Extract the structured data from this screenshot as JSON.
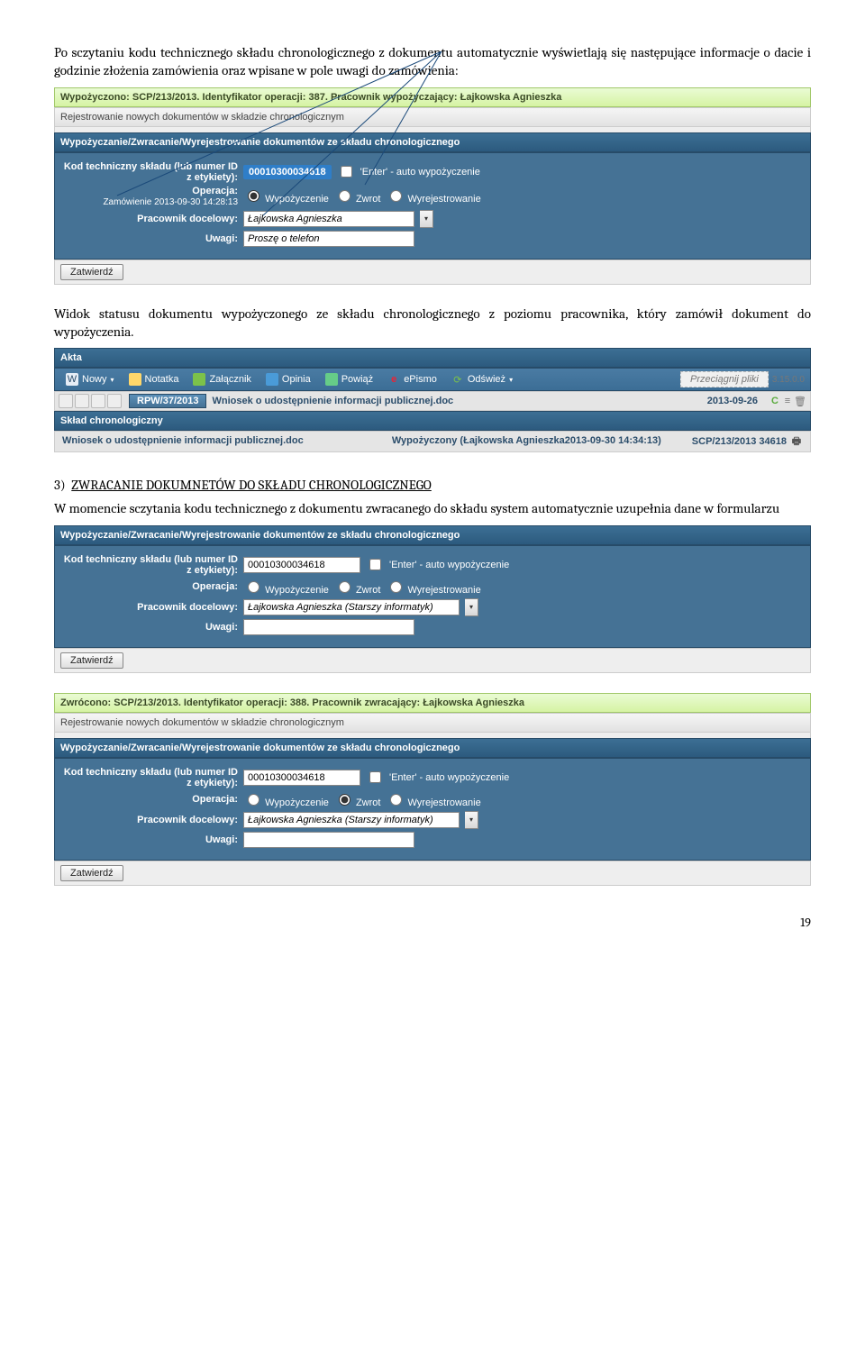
{
  "intro1": "Po sczytaniu kodu technicznego składu chronologicznego z dokumentu automatycznie wyświetlają się następujące informacje o dacie i godzinie złożenia zamówienia oraz wpisane w pole uwagi do zamówienia:",
  "panel1": {
    "green": "Wypożyczono: SCP/213/2013. Identyfikator operacji: 387. Pracownik wypożyczający: Łajkowska Agnieszka",
    "lightHeader": "Rejestrowanie nowych dokumentów w składzie chronologicznym",
    "blueHeader": "Wypożyczanie/Zwracanie/Wyrejestrowanie dokumentów ze składu chronologicznego",
    "labels": {
      "kod": "Kod techniczny składu (lub numer ID z etykiety):",
      "operacja": "Operacja:",
      "zamowienie": "Zamówienie 2013-09-30 14:28:13",
      "pracownik": "Pracownik docelowy:",
      "uwagi": "Uwagi:"
    },
    "kodValue": "00010300034618",
    "enterAuto": "'Enter' - auto wypożyczenie",
    "op": {
      "wyp": "Wypożyczenie",
      "zwr": "Zwrot",
      "wyr": "Wyrejestrowanie"
    },
    "pracownikValue": "Łajkowska Agnieszka",
    "uwagiValue": "Proszę o telefon",
    "button": "Zatwierdź"
  },
  "intro2": "Widok statusu dokumentu wypożyczonego ze składu chronologicznego z poziomu pracownika, który zamówił dokument do wypożyczenia.",
  "akta": {
    "aktaHeader": "Akta",
    "toolbar": {
      "nowy": "Nowy",
      "notatka": "Notatka",
      "zalacznik": "Załącznik",
      "opinia": "Opinia",
      "powiaz": "Powiąż",
      "epismo": "ePismo",
      "odswiez": "Odśwież",
      "drag": "Przeciągnij pliki",
      "ver": "3.15.0.0"
    },
    "rpw": "RPW/37/2013",
    "docName": "Wniosek o udostępnienie informacji publicznej.doc",
    "docDate": "2013-09-26",
    "skladHeader": "Skład chronologiczny",
    "skladDoc": "Wniosek o udostępnienie informacji publicznej.doc",
    "skladStatus": "Wypożyczony (Łajkowska Agnieszka2013-09-30 14:34:13)",
    "skladScp": "SCP/213/2013 34618"
  },
  "section3": {
    "num": "3)",
    "title": "ZWRACANIE DOKUMNETÓW DO SKŁADU CHRONOLOGICZNEGO",
    "text": "W momencie sczytania kodu technicznego z dokumentu zwracanego do składu system automatycznie uzupełnia dane w formularzu"
  },
  "panel2": {
    "blueHeader": "Wypożyczanie/Zwracanie/Wyrejestrowanie dokumentów ze składu chronologicznego",
    "labels": {
      "kod": "Kod techniczny składu (lub numer ID z etykiety):",
      "operacja": "Operacja:",
      "pracownik": "Pracownik docelowy:",
      "uwagi": "Uwagi:"
    },
    "kodValue": "00010300034618",
    "enterAuto": "'Enter' - auto wypożyczenie",
    "op": {
      "wyp": "Wypożyczenie",
      "zwr": "Zwrot",
      "wyr": "Wyrejestrowanie"
    },
    "pracownikValue": "Łajkowska Agnieszka (Starszy informatyk)",
    "uwagiValue": "",
    "button": "Zatwierdź"
  },
  "panel3": {
    "green": "Zwrócono: SCP/213/2013. Identyfikator operacji: 388. Pracownik zwracający: Łajkowska Agnieszka",
    "lightHeader": "Rejestrowanie nowych dokumentów w składzie chronologicznym",
    "blueHeader": "Wypożyczanie/Zwracanie/Wyrejestrowanie dokumentów ze składu chronologicznego",
    "labels": {
      "kod": "Kod techniczny składu (lub numer ID z etykiety):",
      "operacja": "Operacja:",
      "pracownik": "Pracownik docelowy:",
      "uwagi": "Uwagi:"
    },
    "kodValue": "00010300034618",
    "enterAuto": "'Enter' - auto wypożyczenie",
    "op": {
      "wyp": "Wypożyczenie",
      "zwr": "Zwrot",
      "wyr": "Wyrejestrowanie"
    },
    "pracownikValue": "Łajkowska Agnieszka (Starszy informatyk)",
    "uwagiValue": "",
    "button": "Zatwierdź"
  },
  "pageNum": "19"
}
